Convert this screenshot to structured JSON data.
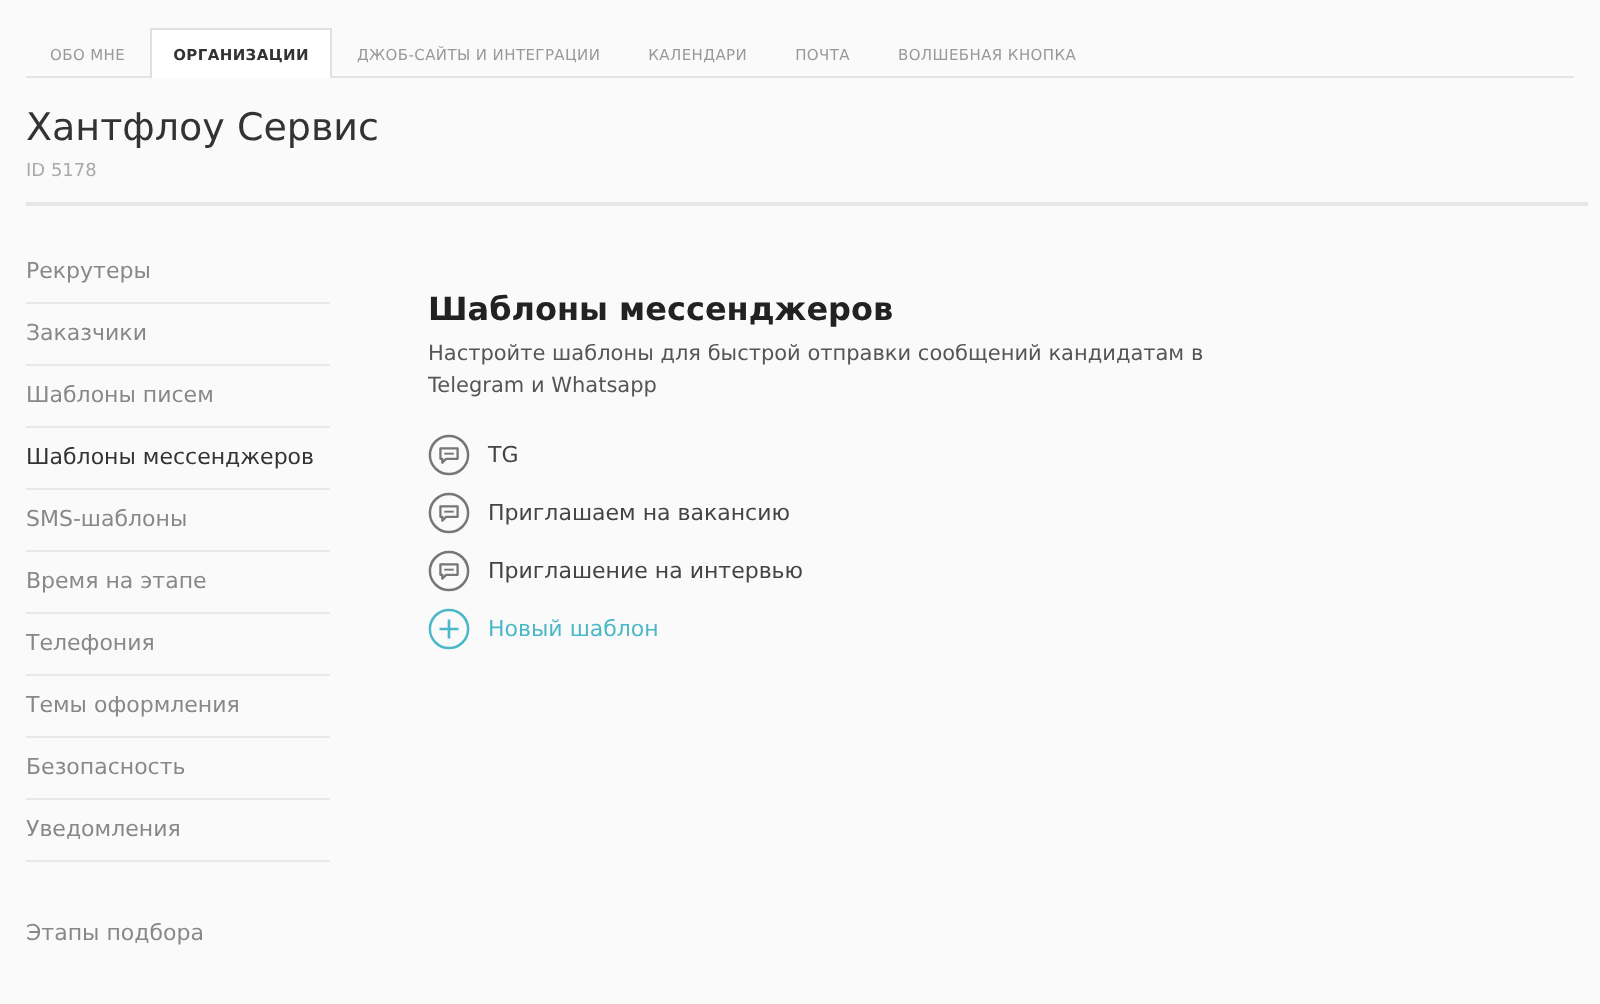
{
  "tabs": [
    {
      "label": "ОБО МНЕ",
      "selected": false
    },
    {
      "label": "ОРГАНИЗАЦИИ",
      "selected": true
    },
    {
      "label": "ДЖОБ-САЙТЫ И ИНТЕГРАЦИИ",
      "selected": false
    },
    {
      "label": "КАЛЕНДАРИ",
      "selected": false
    },
    {
      "label": "ПОЧТА",
      "selected": false
    },
    {
      "label": "ВОЛШЕБНАЯ КНОПКА",
      "selected": false
    }
  ],
  "organization": {
    "name": "Хантфлоу Сервис",
    "id": "ID 5178"
  },
  "sidebar": {
    "items": [
      {
        "label": "Рекрутеры",
        "selected": false
      },
      {
        "label": "Заказчики",
        "selected": false
      },
      {
        "label": "Шаблоны писем",
        "selected": false
      },
      {
        "label": "Шаблоны мессенджеров",
        "selected": true
      },
      {
        "label": "SMS-шаблоны",
        "selected": false
      },
      {
        "label": "Время на этапе",
        "selected": false
      },
      {
        "label": "Телефония",
        "selected": false
      },
      {
        "label": "Темы оформления",
        "selected": false
      },
      {
        "label": "Безопасность",
        "selected": false
      },
      {
        "label": "Уведомления",
        "selected": false
      }
    ],
    "footer_item": "Этапы подбора"
  },
  "content": {
    "title": "Шаблоны мессенджеров",
    "description": "Настройте шаблоны для быстрой отправки сообщений кандидатам в Telegram и Whatsapp",
    "templates": [
      {
        "kind": "template",
        "label": "TG"
      },
      {
        "kind": "template",
        "label": "Приглашаем на вакансию"
      },
      {
        "kind": "template",
        "label": "Приглашение на интервью"
      },
      {
        "kind": "add",
        "label": "Новый шаблон"
      }
    ]
  }
}
